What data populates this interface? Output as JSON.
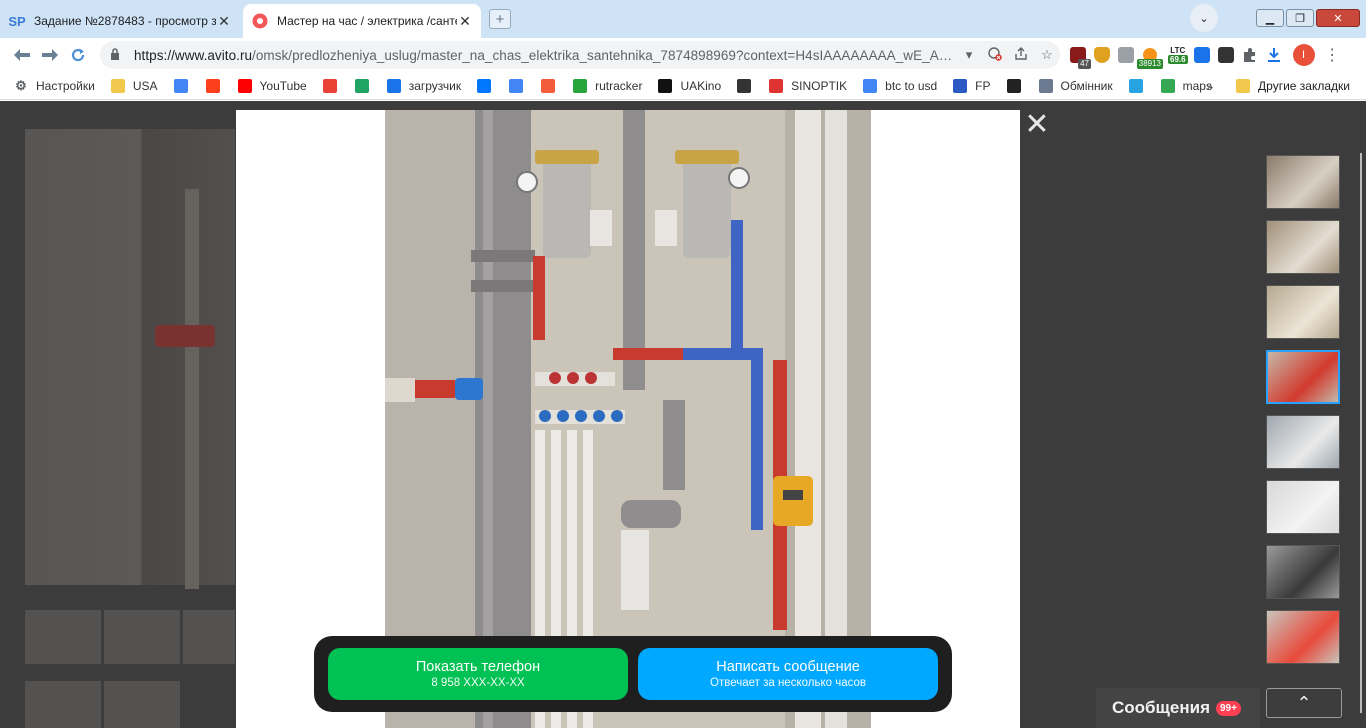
{
  "tabs": [
    {
      "favicon": "SP",
      "title": "Задание №2878483 - просмотр з",
      "close": "✕"
    },
    {
      "favicon": "avito-icon",
      "title": "Мастер на час / электрика /санте",
      "close": "✕"
    }
  ],
  "window": {
    "minimize": "▁",
    "restore": "❐",
    "close": "✕",
    "profile_menu": "⌄"
  },
  "toolbar": {
    "url_host": "https://www.avito.ru",
    "url_path": "/omsk/predlozheniya_uslug/master_na_chas_elektrika_santehnika_7874898969?context=H4sIAAAAAAAA_wE_A…",
    "extensions": {
      "badge_47": "47",
      "btc_price": "38913",
      "ltc_label": "LTC",
      "ltc_price": "69.6"
    },
    "avatar_initial": "I"
  },
  "bookmarks": [
    {
      "label": "Настройки",
      "icon": "gear-icon"
    },
    {
      "label": "USA",
      "icon": "folder-icon"
    },
    {
      "label": "",
      "icon": "google-icon"
    },
    {
      "label": "",
      "icon": "yandex-icon"
    },
    {
      "label": "YouTube",
      "icon": "youtube-icon"
    },
    {
      "label": "",
      "icon": "gmail-icon"
    },
    {
      "label": "",
      "icon": "drive-icon"
    },
    {
      "label": "загрузчик",
      "icon": "infinity-icon"
    },
    {
      "label": "",
      "icon": "vk-icon"
    },
    {
      "label": "",
      "icon": "translate-icon"
    },
    {
      "label": "",
      "icon": "f-icon"
    },
    {
      "label": "rutracker",
      "icon": "rutracker-icon"
    },
    {
      "label": "UAKino",
      "icon": "uakino-icon"
    },
    {
      "label": "",
      "icon": "chess-icon"
    },
    {
      "label": "SINOPTIK",
      "icon": "thermometer-icon"
    },
    {
      "label": "btc to usd",
      "icon": "google-icon"
    },
    {
      "label": "FP",
      "icon": "fp-icon"
    },
    {
      "label": "",
      "icon": "bc-icon"
    },
    {
      "label": "Обмінник",
      "icon": "diamond-icon"
    },
    {
      "label": "",
      "icon": "star-icon"
    },
    {
      "label": "maps",
      "icon": "maps-pin-icon"
    }
  ],
  "bookmarks_more": "»",
  "other_bookmarks": "Другие закладки",
  "gallery": {
    "close": "✕",
    "thumbnail_count": 8,
    "selected_index": 3
  },
  "cta": {
    "phone_label": "Показать телефон",
    "phone_number": "8 958 XXX-XX-XX",
    "message_label": "Написать сообщение",
    "message_sub": "Отвечает за несколько часов"
  },
  "messages": {
    "label": "Сообщения",
    "count": "99+",
    "expand": "⌃"
  }
}
